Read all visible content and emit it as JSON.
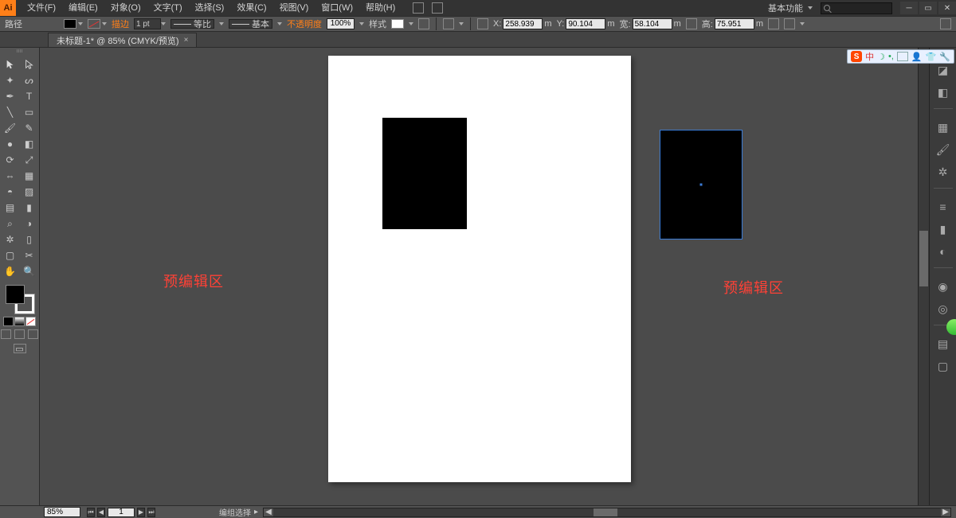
{
  "app": {
    "logo_text": "Ai"
  },
  "menu": {
    "file": "文件(F)",
    "edit": "编辑(E)",
    "object": "对象(O)",
    "type": "文字(T)",
    "select": "选择(S)",
    "effect": "效果(C)",
    "view": "视图(V)",
    "window": "窗口(W)",
    "help": "帮助(H)"
  },
  "workspace_label": "基本功能",
  "path_label": "路径",
  "control": {
    "stroke_label": "描边",
    "stroke_val": "1 pt",
    "dash_label": "等比",
    "profile_label": "基本",
    "opacity_label": "不透明度",
    "opacity_val": "100%",
    "style_label": "样式",
    "x_label": "X:",
    "x_val": "258.939",
    "y_label": "Y:",
    "y_val": "90.104",
    "w_label": "宽:",
    "w_val": "58.104",
    "h_label": "高:",
    "h_val": "75.951",
    "mm": "m"
  },
  "tab": {
    "title": "未标题-1* @ 85% (CMYK/预览)"
  },
  "labels": {
    "preview_area": "预编辑区"
  },
  "status": {
    "zoom": "85%",
    "page": "1",
    "selection": "编组选择"
  },
  "ime": {
    "cn": "中"
  }
}
